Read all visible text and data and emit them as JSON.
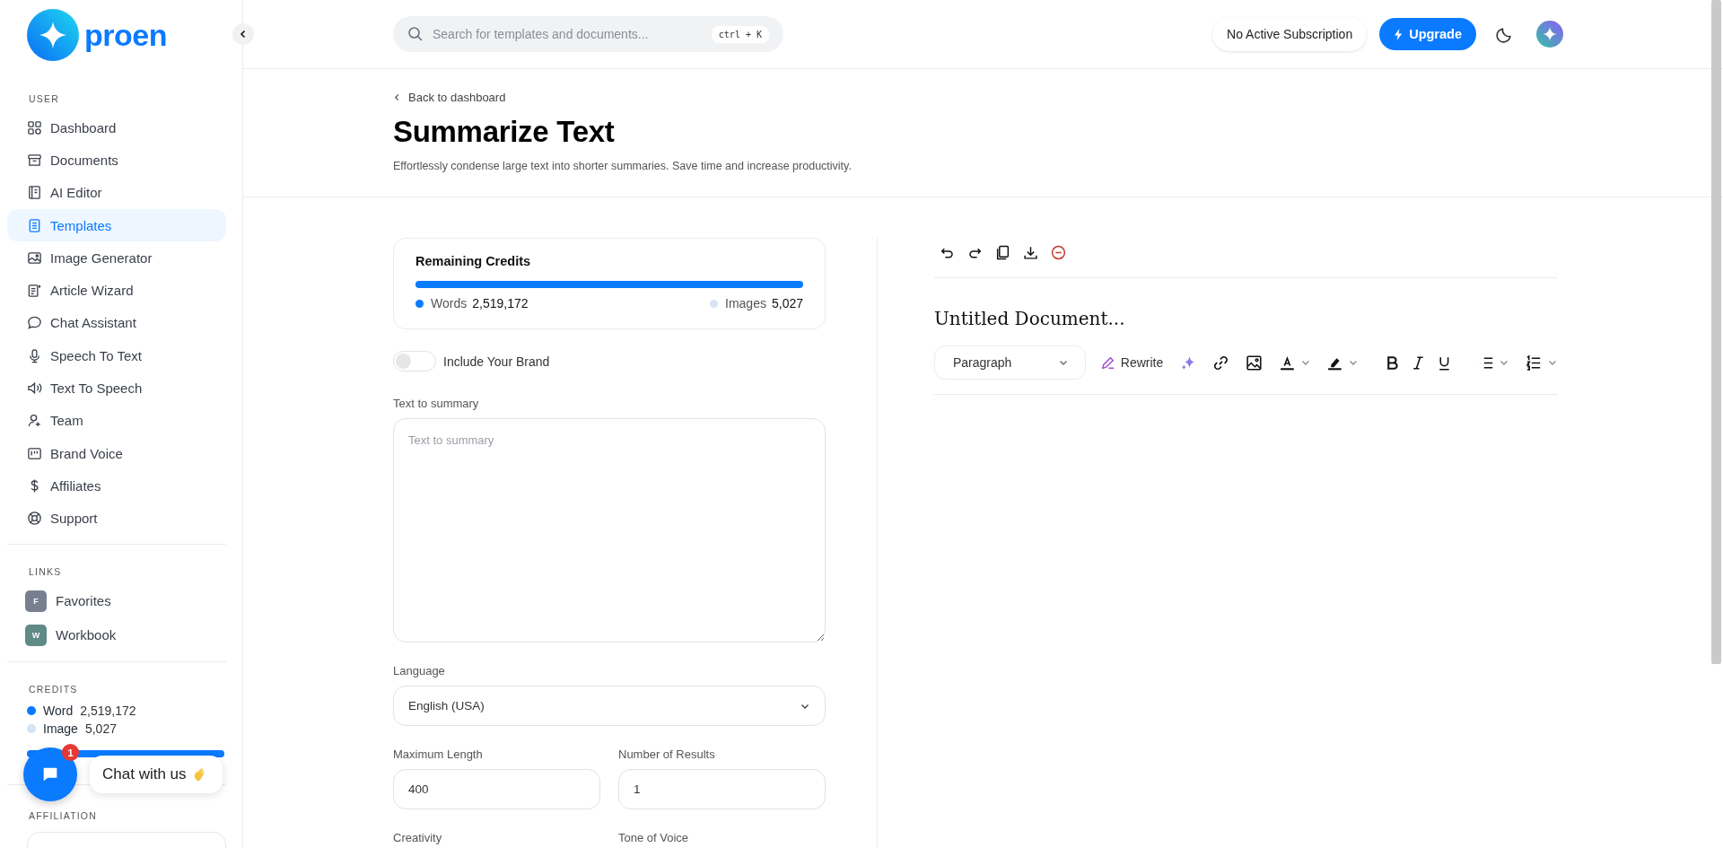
{
  "sidebar": {
    "logo": "proen",
    "sections": [
      {
        "title": "USER",
        "items": [
          {
            "label": "Dashboard",
            "selected": false
          },
          {
            "label": "Documents",
            "selected": false
          },
          {
            "label": "AI Editor",
            "selected": false
          },
          {
            "label": "Templates",
            "selected": true
          },
          {
            "label": "Image Generator",
            "selected": false
          },
          {
            "label": "Article Wizard",
            "selected": false
          },
          {
            "label": "Chat Assistant",
            "selected": false
          },
          {
            "label": "Speech To Text",
            "selected": false
          },
          {
            "label": "Text To Speech",
            "selected": false
          },
          {
            "label": "Team",
            "selected": false
          },
          {
            "label": "Brand Voice",
            "selected": false
          },
          {
            "label": "Affiliates",
            "selected": false
          },
          {
            "label": "Support",
            "selected": false
          }
        ]
      }
    ],
    "links_title": "LINKS",
    "links": [
      {
        "letter": "F",
        "label": "Favorites",
        "color": "#787f91"
      },
      {
        "letter": "W",
        "label": "Workbook",
        "color": "#5f8a86"
      }
    ],
    "credits_title": "CREDITS",
    "credits": [
      {
        "label": "Word",
        "value": "2,519,172",
        "color": "#0a7aff"
      },
      {
        "label": "Image",
        "value": "5,027",
        "color": "#d5e3f3"
      }
    ],
    "credits_bar": {
      "level": 1
    },
    "affiliation_title": "AFFILIATION"
  },
  "topbar": {
    "search_placeholder": "Search for templates and documents...",
    "shortcut": "ctrl + K",
    "subscription": "No Active Subscription",
    "upgrade": "Upgrade"
  },
  "header": {
    "back": "Back to dashboard",
    "title": "Summarize Text",
    "subtitle": "Effortlessly condense large text into shorter summaries. Save time and increase productivity."
  },
  "credits_card": {
    "title": "Remaining Credits",
    "level": 1,
    "items": [
      {
        "label": "Words",
        "value": "2,519,172",
        "color": "#0a7aff"
      },
      {
        "label": "Images",
        "value": "5,027",
        "color": "#d5e3f3"
      }
    ]
  },
  "brand_toggle": {
    "label": "Include Your Brand",
    "on": false
  },
  "form": {
    "text": {
      "label": "Text to summary",
      "placeholder": "Text to summary"
    },
    "language": {
      "label": "Language",
      "value": "English (USA)"
    },
    "max_length": {
      "label": "Maximum Length",
      "value": "400"
    },
    "results": {
      "label": "Number of Results",
      "value": "1"
    },
    "creativity": {
      "label": "Creativity"
    },
    "tone": {
      "label": "Tone of Voice"
    }
  },
  "editor": {
    "title": "Untitled Document...",
    "format": "Paragraph",
    "rewrite": "Rewrite"
  },
  "chat": {
    "label": "Chat with us",
    "badge": "1"
  }
}
